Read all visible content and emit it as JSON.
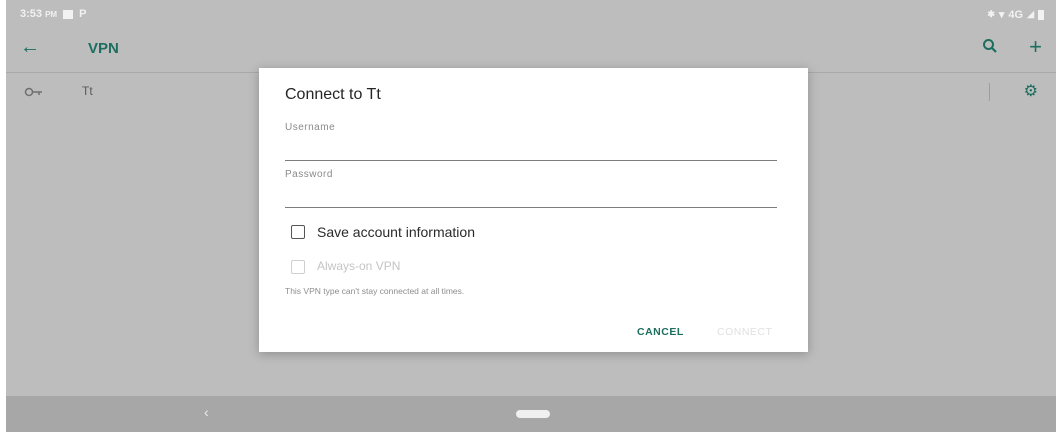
{
  "status_bar": {
    "time": "3:53",
    "ampm": "PM",
    "network": "4G",
    "bluetooth_icon": "bluetooth-icon",
    "wifi_icon": "wifi-icon",
    "signal_icon": "signal-icon",
    "battery_icon": "battery-icon"
  },
  "toolbar": {
    "title": "VPN",
    "back_icon": "arrow-back-icon",
    "search_icon": "search-icon",
    "add_icon": "plus-icon"
  },
  "vpn_list": [
    {
      "name": "Tt",
      "icon": "vpn-key-icon",
      "settings_icon": "gear-icon"
    }
  ],
  "dialog": {
    "title": "Connect to Tt",
    "username_label": "Username",
    "username_value": "",
    "password_label": "Password",
    "password_value": "",
    "save_account_label": "Save account information",
    "save_account_checked": false,
    "always_on_label": "Always-on VPN",
    "always_on_checked": false,
    "always_on_note": "This VPN type can't stay connected at all times.",
    "cancel_label": "CANCEL",
    "connect_label": "CONNECT"
  },
  "nav_bar": {
    "back_icon": "nav-back-icon",
    "home_icon": "home-pill-icon"
  },
  "colors": {
    "accent": "#1c6e5e",
    "scrim": "#bdbdbd",
    "dialog": "#ffffff"
  }
}
